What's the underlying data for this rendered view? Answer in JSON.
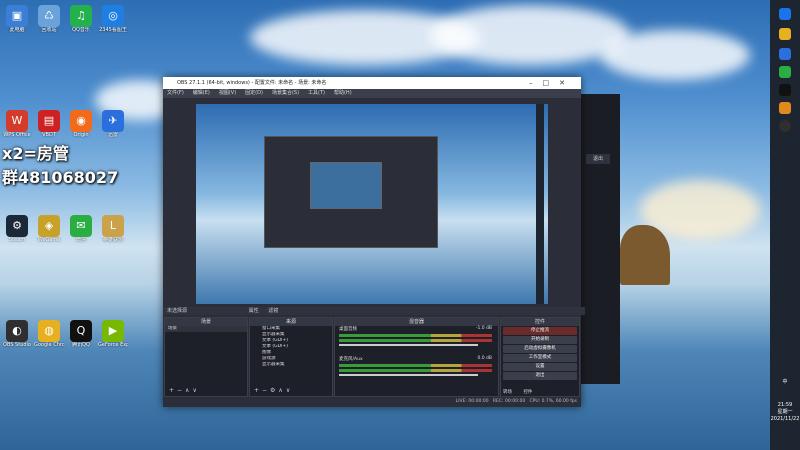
{
  "desktop": {
    "icons": [
      {
        "label": "此电脑",
        "color": "#3a7fd5",
        "glyph": "▣"
      },
      {
        "label": "回收站",
        "color": "#6aa3d9",
        "glyph": "♺"
      },
      {
        "label": "QQ音乐",
        "color": "#23b14d",
        "glyph": "♫"
      },
      {
        "label": "2345看图王",
        "color": "#1f7fe0",
        "glyph": "◎"
      },
      {
        "label": "WPS Office",
        "color": "#d43b2b",
        "glyph": "W"
      },
      {
        "label": "VBDT",
        "color": "#c22",
        "glyph": "▤"
      },
      {
        "label": "Origin",
        "color": "#f26a1b",
        "glyph": "◉"
      },
      {
        "label": "迅雷",
        "color": "#2a6fdb",
        "glyph": "✈"
      },
      {
        "label": "Steam",
        "color": "#1b2838",
        "glyph": "⚙"
      },
      {
        "label": "WeGame",
        "color": "#c8a12a",
        "glyph": "◈"
      },
      {
        "label": "微信",
        "color": "#2aae43",
        "glyph": "✉"
      },
      {
        "label": "英雄联盟",
        "color": "#c9a24a",
        "glyph": "L"
      },
      {
        "label": "OBS Studio",
        "color": "#302e31",
        "glyph": "◐"
      },
      {
        "label": "Google Chrome",
        "color": "#e6b021",
        "glyph": "◍"
      },
      {
        "label": "腾讯QQ",
        "color": "#111",
        "glyph": "Q"
      },
      {
        "label": "GeForce Experience",
        "color": "#76b900",
        "glyph": "▶"
      }
    ],
    "watermark": {
      "line1": "x2=房管",
      "line2": "群481068027"
    }
  },
  "taskbar": {
    "time": "21:59",
    "day": "星期一",
    "date": "2021/11/22",
    "language": "中",
    "volume_icon": "speaker-icon"
  },
  "obs": {
    "title": "OBS 27.1.1 (64-bit, windows) - 配置文件: 未命名 - 场景: 未命名",
    "menu": [
      "文件(F)",
      "编辑(E)",
      "视图(V)",
      "固定(D)",
      "场景集合(S)",
      "工具(T)",
      "帮助(H)"
    ],
    "source_bar": {
      "label": "未选择源",
      "properties": "属性",
      "filters": "滤镜"
    },
    "scenes": {
      "header": "场景",
      "items": [
        "场景"
      ]
    },
    "sources": {
      "header": "来源",
      "items": [
        "窗口采集",
        "显示器采集",
        "文本 (GDI+)",
        "文本 (GDI+)",
        "图像",
        "游戏源",
        "显示器采集"
      ]
    },
    "mixer": {
      "header": "混音器",
      "channels": [
        {
          "name": "桌面音频",
          "db": "-1.0 dB"
        },
        {
          "name": "麦克风/Aux",
          "db": "0.0 dB"
        }
      ]
    },
    "controls": {
      "header": "控件",
      "buttons": [
        "停止推流",
        "开始录制",
        "启动虚拟摄像机",
        "工作室模式",
        "设置",
        "退出"
      ]
    },
    "transitions_tab": "转场",
    "studio_tab": "控件",
    "status": {
      "live": "LIVE: 00:00:00",
      "rec": "REC: 00:00:00",
      "cpu": "CPU: 0.7%, 60.00 fps",
      "kbps": "12 fps"
    }
  },
  "background_window": {
    "button": "退出"
  }
}
